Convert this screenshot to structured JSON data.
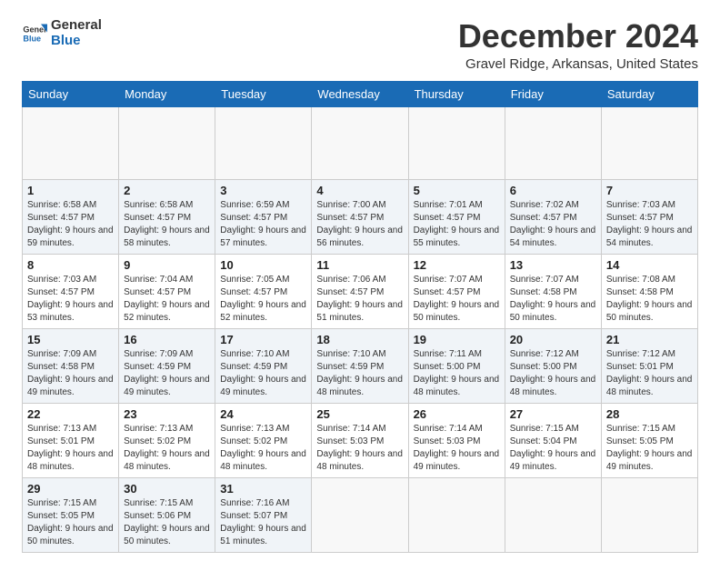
{
  "header": {
    "logo": {
      "text_general": "General",
      "text_blue": "Blue"
    },
    "title": "December 2024",
    "location": "Gravel Ridge, Arkansas, United States"
  },
  "calendar": {
    "days_of_week": [
      "Sunday",
      "Monday",
      "Tuesday",
      "Wednesday",
      "Thursday",
      "Friday",
      "Saturday"
    ],
    "weeks": [
      [
        {
          "day": "",
          "empty": true
        },
        {
          "day": "",
          "empty": true
        },
        {
          "day": "",
          "empty": true
        },
        {
          "day": "",
          "empty": true
        },
        {
          "day": "",
          "empty": true
        },
        {
          "day": "",
          "empty": true
        },
        {
          "day": "",
          "empty": true
        }
      ],
      [
        {
          "day": "1",
          "info": "Sunrise: 6:58 AM\nSunset: 4:57 PM\nDaylight: 9 hours and 59 minutes."
        },
        {
          "day": "2",
          "info": "Sunrise: 6:58 AM\nSunset: 4:57 PM\nDaylight: 9 hours and 58 minutes."
        },
        {
          "day": "3",
          "info": "Sunrise: 6:59 AM\nSunset: 4:57 PM\nDaylight: 9 hours and 57 minutes."
        },
        {
          "day": "4",
          "info": "Sunrise: 7:00 AM\nSunset: 4:57 PM\nDaylight: 9 hours and 56 minutes."
        },
        {
          "day": "5",
          "info": "Sunrise: 7:01 AM\nSunset: 4:57 PM\nDaylight: 9 hours and 55 minutes."
        },
        {
          "day": "6",
          "info": "Sunrise: 7:02 AM\nSunset: 4:57 PM\nDaylight: 9 hours and 54 minutes."
        },
        {
          "day": "7",
          "info": "Sunrise: 7:03 AM\nSunset: 4:57 PM\nDaylight: 9 hours and 54 minutes."
        }
      ],
      [
        {
          "day": "8",
          "info": "Sunrise: 7:03 AM\nSunset: 4:57 PM\nDaylight: 9 hours and 53 minutes."
        },
        {
          "day": "9",
          "info": "Sunrise: 7:04 AM\nSunset: 4:57 PM\nDaylight: 9 hours and 52 minutes."
        },
        {
          "day": "10",
          "info": "Sunrise: 7:05 AM\nSunset: 4:57 PM\nDaylight: 9 hours and 52 minutes."
        },
        {
          "day": "11",
          "info": "Sunrise: 7:06 AM\nSunset: 4:57 PM\nDaylight: 9 hours and 51 minutes."
        },
        {
          "day": "12",
          "info": "Sunrise: 7:07 AM\nSunset: 4:57 PM\nDaylight: 9 hours and 50 minutes."
        },
        {
          "day": "13",
          "info": "Sunrise: 7:07 AM\nSunset: 4:58 PM\nDaylight: 9 hours and 50 minutes."
        },
        {
          "day": "14",
          "info": "Sunrise: 7:08 AM\nSunset: 4:58 PM\nDaylight: 9 hours and 50 minutes."
        }
      ],
      [
        {
          "day": "15",
          "info": "Sunrise: 7:09 AM\nSunset: 4:58 PM\nDaylight: 9 hours and 49 minutes."
        },
        {
          "day": "16",
          "info": "Sunrise: 7:09 AM\nSunset: 4:59 PM\nDaylight: 9 hours and 49 minutes."
        },
        {
          "day": "17",
          "info": "Sunrise: 7:10 AM\nSunset: 4:59 PM\nDaylight: 9 hours and 49 minutes."
        },
        {
          "day": "18",
          "info": "Sunrise: 7:10 AM\nSunset: 4:59 PM\nDaylight: 9 hours and 48 minutes."
        },
        {
          "day": "19",
          "info": "Sunrise: 7:11 AM\nSunset: 5:00 PM\nDaylight: 9 hours and 48 minutes."
        },
        {
          "day": "20",
          "info": "Sunrise: 7:12 AM\nSunset: 5:00 PM\nDaylight: 9 hours and 48 minutes."
        },
        {
          "day": "21",
          "info": "Sunrise: 7:12 AM\nSunset: 5:01 PM\nDaylight: 9 hours and 48 minutes."
        }
      ],
      [
        {
          "day": "22",
          "info": "Sunrise: 7:13 AM\nSunset: 5:01 PM\nDaylight: 9 hours and 48 minutes."
        },
        {
          "day": "23",
          "info": "Sunrise: 7:13 AM\nSunset: 5:02 PM\nDaylight: 9 hours and 48 minutes."
        },
        {
          "day": "24",
          "info": "Sunrise: 7:13 AM\nSunset: 5:02 PM\nDaylight: 9 hours and 48 minutes."
        },
        {
          "day": "25",
          "info": "Sunrise: 7:14 AM\nSunset: 5:03 PM\nDaylight: 9 hours and 48 minutes."
        },
        {
          "day": "26",
          "info": "Sunrise: 7:14 AM\nSunset: 5:03 PM\nDaylight: 9 hours and 49 minutes."
        },
        {
          "day": "27",
          "info": "Sunrise: 7:15 AM\nSunset: 5:04 PM\nDaylight: 9 hours and 49 minutes."
        },
        {
          "day": "28",
          "info": "Sunrise: 7:15 AM\nSunset: 5:05 PM\nDaylight: 9 hours and 49 minutes."
        }
      ],
      [
        {
          "day": "29",
          "info": "Sunrise: 7:15 AM\nSunset: 5:05 PM\nDaylight: 9 hours and 50 minutes."
        },
        {
          "day": "30",
          "info": "Sunrise: 7:15 AM\nSunset: 5:06 PM\nDaylight: 9 hours and 50 minutes."
        },
        {
          "day": "31",
          "info": "Sunrise: 7:16 AM\nSunset: 5:07 PM\nDaylight: 9 hours and 51 minutes."
        },
        {
          "day": "",
          "empty": true
        },
        {
          "day": "",
          "empty": true
        },
        {
          "day": "",
          "empty": true
        },
        {
          "day": "",
          "empty": true
        }
      ]
    ]
  }
}
